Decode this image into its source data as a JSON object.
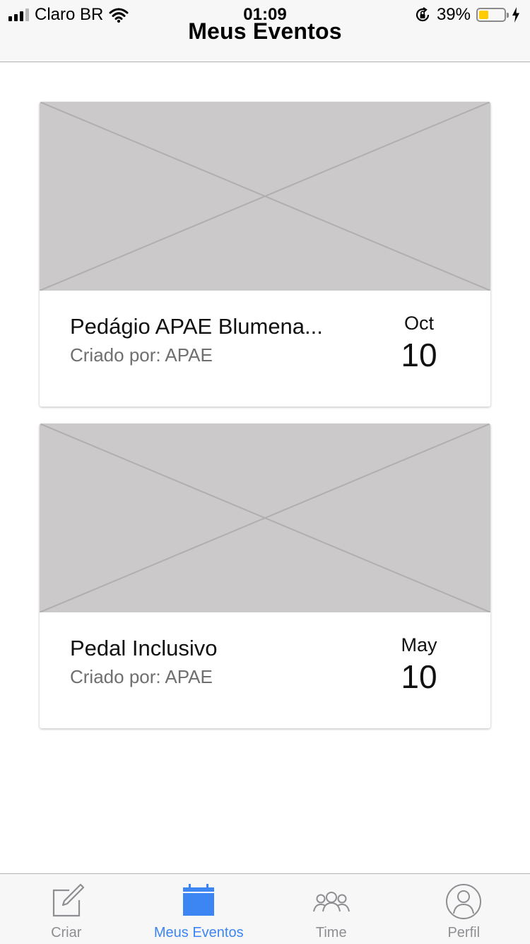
{
  "status_bar": {
    "carrier": "Claro BR",
    "time": "01:09",
    "battery_percent": "39%",
    "battery_level": 0.39,
    "battery_color": "#ffcc00"
  },
  "header": {
    "title": "Meus Eventos"
  },
  "events": [
    {
      "title": "Pedágio APAE Blumena...",
      "creator": "Criado por: APAE",
      "month": "Oct",
      "day": "10"
    },
    {
      "title": "Pedal Inclusivo",
      "creator": "Criado por: APAE",
      "month": "May",
      "day": "10"
    }
  ],
  "tabbar": {
    "active_color": "#3b86f3",
    "items": [
      {
        "label": "Criar",
        "icon": "compose-icon",
        "active": false
      },
      {
        "label": "Meus Eventos",
        "icon": "calendar-icon",
        "active": true
      },
      {
        "label": "Time",
        "icon": "team-icon",
        "active": false
      },
      {
        "label": "Perfil",
        "icon": "profile-icon",
        "active": false
      }
    ]
  }
}
